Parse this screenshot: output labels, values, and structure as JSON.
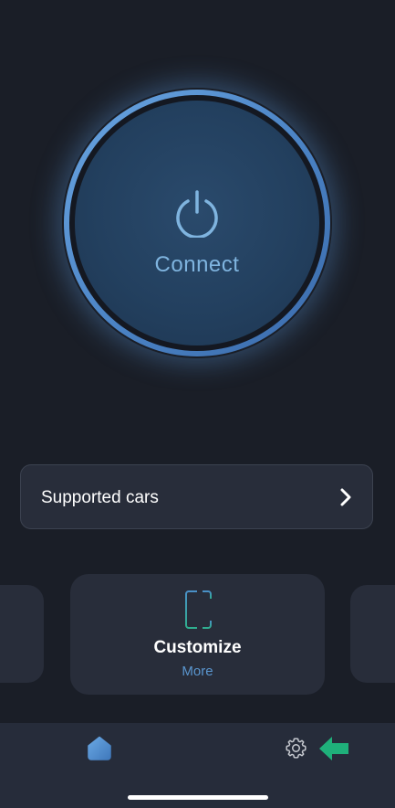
{
  "connect": {
    "label": "Connect",
    "icon": "power-icon",
    "ring_color": "#5a96d8",
    "label_color": "#7fb4df"
  },
  "supported_cars": {
    "label": "Supported cars",
    "icon": "chevron-right-icon"
  },
  "carousel": {
    "active_card": {
      "title": "Customize",
      "subtitle": "More",
      "icon": "customize-sliders-icon"
    }
  },
  "bottom_nav": {
    "items": [
      {
        "icon": "home-icon",
        "active": true,
        "color": "#5a96d8"
      },
      {
        "icon": "gear-icon",
        "active": false
      }
    ],
    "annotation_arrow": {
      "icon": "arrow-left-icon",
      "color": "#1fb07a"
    }
  },
  "colors": {
    "background": "#1a1e27",
    "card": "#282d3a",
    "accent_blue": "#5a96d8",
    "accent_green": "#1fb07a"
  }
}
